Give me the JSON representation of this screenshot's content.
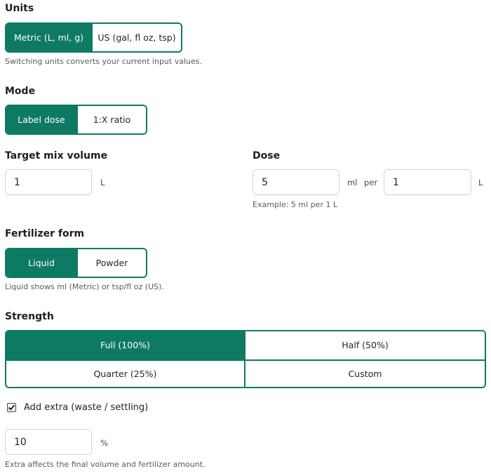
{
  "units": {
    "title": "Units",
    "options": [
      "Metric (L, ml, g)",
      "US (gal, fl oz, tsp)"
    ],
    "selected": "Metric (L, ml, g)",
    "help": "Switching units converts your current input values."
  },
  "mode": {
    "title": "Mode",
    "options": [
      "Label dose",
      "1:X ratio"
    ],
    "selected": "Label dose"
  },
  "target": {
    "label": "Target mix volume",
    "value": "1",
    "unit": "L"
  },
  "dose": {
    "label": "Dose",
    "value": "5",
    "unit": "ml",
    "per_label": "per",
    "per_value": "1",
    "per_unit": "L",
    "example": "Example: 5 ml per 1 L"
  },
  "form": {
    "title": "Fertilizer form",
    "options": [
      "Liquid",
      "Powder"
    ],
    "selected": "Liquid",
    "help": "Liquid shows ml (Metric) or tsp/fl oz (US)."
  },
  "strength": {
    "title": "Strength",
    "options": [
      "Full (100%)",
      "Half (50%)",
      "Quarter (25%)",
      "Custom"
    ],
    "selected": "Full (100%)"
  },
  "extra": {
    "checkbox_label": "Add extra (waste / settling)",
    "checked": true,
    "value": "10",
    "unit": "%",
    "help": "Extra affects the final volume and fertilizer amount."
  }
}
